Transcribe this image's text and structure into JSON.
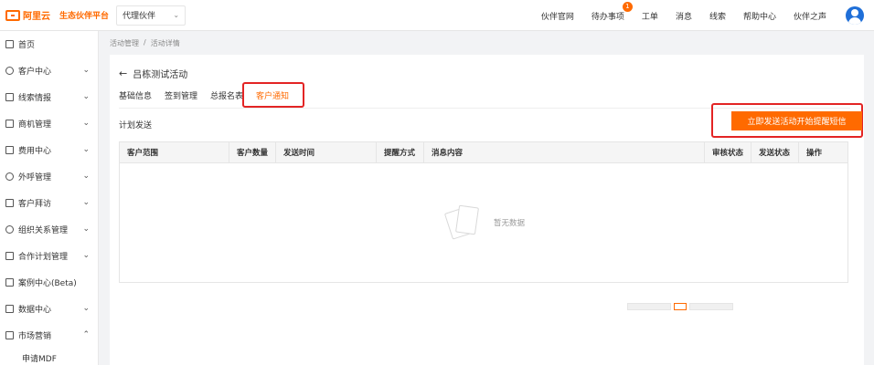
{
  "header": {
    "logo_text": "阿里云",
    "platform_name": "生态伙伴平台",
    "role_select": "代理伙伴",
    "nav": [
      "伙伴官网",
      "待办事项",
      "工单",
      "消息",
      "线索",
      "帮助中心",
      "伙伴之声"
    ],
    "todo_badge": "1"
  },
  "sidebar": {
    "items": [
      {
        "label": "首页",
        "expandable": false
      },
      {
        "label": "客户中心",
        "expandable": true
      },
      {
        "label": "线索情报",
        "expandable": true
      },
      {
        "label": "商机管理",
        "expandable": true
      },
      {
        "label": "费用中心",
        "expandable": true
      },
      {
        "label": "外呼管理",
        "expandable": true
      },
      {
        "label": "客户拜访",
        "expandable": true
      },
      {
        "label": "组织关系管理",
        "expandable": true
      },
      {
        "label": "合作计划管理",
        "expandable": true
      },
      {
        "label": "案例中心(Beta)",
        "expandable": false
      },
      {
        "label": "数据中心",
        "expandable": true
      },
      {
        "label": "市场营销",
        "expandable": true
      },
      {
        "label": "申请MDF",
        "expandable": false
      }
    ]
  },
  "breadcrumb": [
    "活动管理",
    "/",
    "活动详情"
  ],
  "activity": {
    "title": "吕栋测试活动",
    "tabs": [
      {
        "label": "基础信息",
        "active": false
      },
      {
        "label": "签到管理",
        "active": false
      },
      {
        "label": "总报名表",
        "active": false
      },
      {
        "label": "客户通知",
        "active": true
      }
    ],
    "section_label": "计划发送",
    "primary_button": "立即发送活动开始提醒短信"
  },
  "table": {
    "columns": [
      "客户范围",
      "客户数量",
      "发送时间",
      "提醒方式",
      "消息内容",
      "审核状态",
      "发送状态",
      "操作"
    ],
    "rows": [],
    "empty_text": "暂无数据"
  },
  "colors": {
    "accent": "#ff6a00",
    "highlight_box": "#e32424",
    "avatar": "#1f6fd8"
  }
}
